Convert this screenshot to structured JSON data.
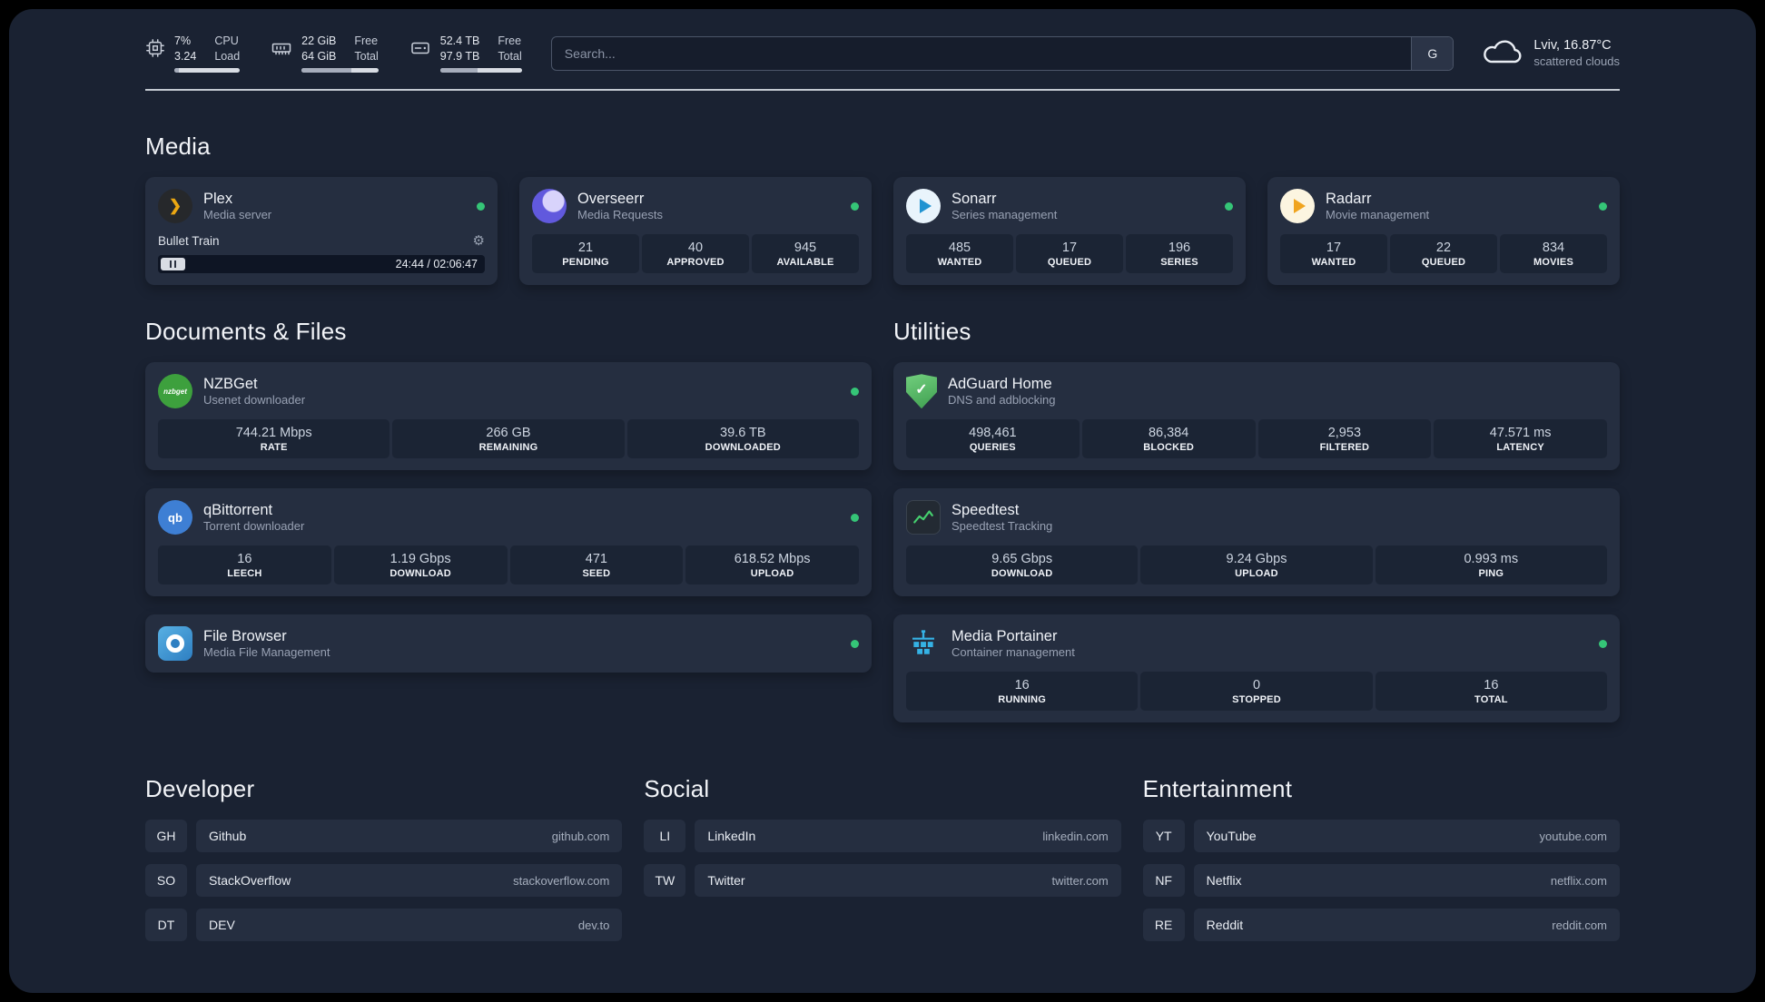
{
  "colors": {
    "status_online": "#35c577",
    "accent_green": "#45cf6e"
  },
  "topbar": {
    "cpu": {
      "value1": "7%",
      "value2": "3.24",
      "label1": "CPU",
      "label2": "Load"
    },
    "memory": {
      "value1": "22 GiB",
      "value2": "64 GiB",
      "label1": "Free",
      "label2": "Total"
    },
    "disk": {
      "value1": "52.4 TB",
      "value2": "97.9 TB",
      "label1": "Free",
      "label2": "Total"
    },
    "search": {
      "placeholder": "Search...",
      "provider": "G"
    },
    "weather": {
      "location": "Lviv, 16.87°C",
      "condition": "scattered clouds"
    }
  },
  "sections": {
    "media": {
      "title": "Media",
      "cards": [
        {
          "name": "Plex",
          "subtitle": "Media server",
          "player": {
            "track": "Bullet Train",
            "time": "24:44 / 02:06:47"
          }
        },
        {
          "name": "Overseerr",
          "subtitle": "Media Requests",
          "stats": [
            {
              "value": "21",
              "label": "PENDING"
            },
            {
              "value": "40",
              "label": "APPROVED"
            },
            {
              "value": "945",
              "label": "AVAILABLE"
            }
          ]
        },
        {
          "name": "Sonarr",
          "subtitle": "Series management",
          "stats": [
            {
              "value": "485",
              "label": "WANTED"
            },
            {
              "value": "17",
              "label": "QUEUED"
            },
            {
              "value": "196",
              "label": "SERIES"
            }
          ]
        },
        {
          "name": "Radarr",
          "subtitle": "Movie management",
          "stats": [
            {
              "value": "17",
              "label": "WANTED"
            },
            {
              "value": "22",
              "label": "QUEUED"
            },
            {
              "value": "834",
              "label": "MOVIES"
            }
          ]
        }
      ]
    },
    "documents": {
      "title": "Documents & Files",
      "cards": [
        {
          "name": "NZBGet",
          "subtitle": "Usenet downloader",
          "icon_text": "nzbget",
          "stats": [
            {
              "value": "744.21 Mbps",
              "label": "RATE"
            },
            {
              "value": "266 GB",
              "label": "REMAINING"
            },
            {
              "value": "39.6 TB",
              "label": "DOWNLOADED"
            }
          ]
        },
        {
          "name": "qBittorrent",
          "subtitle": "Torrent downloader",
          "icon_text": "qb",
          "stats": [
            {
              "value": "16",
              "label": "LEECH"
            },
            {
              "value": "1.19 Gbps",
              "label": "DOWNLOAD"
            },
            {
              "value": "471",
              "label": "SEED"
            },
            {
              "value": "618.52 Mbps",
              "label": "UPLOAD"
            }
          ]
        },
        {
          "name": "File Browser",
          "subtitle": "Media File Management"
        }
      ]
    },
    "utilities": {
      "title": "Utilities",
      "cards": [
        {
          "name": "AdGuard Home",
          "subtitle": "DNS and adblocking",
          "stats": [
            {
              "value": "498,461",
              "label": "QUERIES"
            },
            {
              "value": "86,384",
              "label": "BLOCKED"
            },
            {
              "value": "2,953",
              "label": "FILTERED"
            },
            {
              "value": "47.571 ms",
              "label": "LATENCY"
            }
          ]
        },
        {
          "name": "Speedtest",
          "subtitle": "Speedtest Tracking",
          "stats": [
            {
              "value": "9.65 Gbps",
              "label": "DOWNLOAD"
            },
            {
              "value": "9.24 Gbps",
              "label": "UPLOAD"
            },
            {
              "value": "0.993 ms",
              "label": "PING"
            }
          ]
        },
        {
          "name": "Media Portainer",
          "subtitle": "Container management",
          "stats": [
            {
              "value": "16",
              "label": "RUNNING"
            },
            {
              "value": "0",
              "label": "STOPPED"
            },
            {
              "value": "16",
              "label": "TOTAL"
            }
          ]
        }
      ]
    }
  },
  "bookmarks": {
    "groups": [
      {
        "title": "Developer",
        "items": [
          {
            "abbr": "GH",
            "name": "Github",
            "domain": "github.com"
          },
          {
            "abbr": "SO",
            "name": "StackOverflow",
            "domain": "stackoverflow.com"
          },
          {
            "abbr": "DT",
            "name": "DEV",
            "domain": "dev.to"
          }
        ]
      },
      {
        "title": "Social",
        "items": [
          {
            "abbr": "LI",
            "name": "LinkedIn",
            "domain": "linkedin.com"
          },
          {
            "abbr": "TW",
            "name": "Twitter",
            "domain": "twitter.com"
          }
        ]
      },
      {
        "title": "Entertainment",
        "items": [
          {
            "abbr": "YT",
            "name": "YouTube",
            "domain": "youtube.com"
          },
          {
            "abbr": "NF",
            "name": "Netflix",
            "domain": "netflix.com"
          },
          {
            "abbr": "RE",
            "name": "Reddit",
            "domain": "reddit.com"
          }
        ]
      }
    ]
  }
}
